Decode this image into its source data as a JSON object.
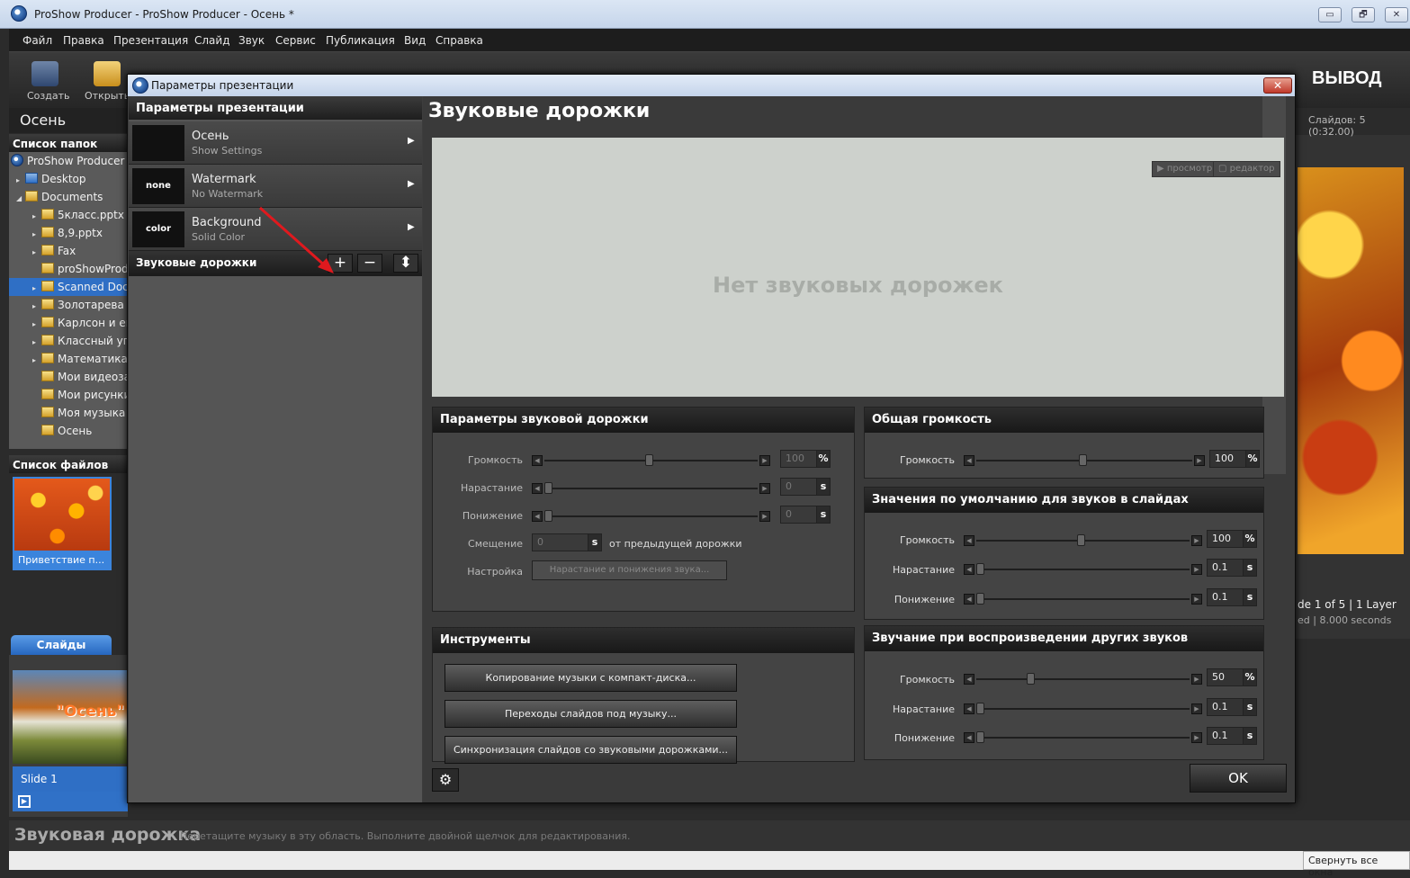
{
  "window": {
    "title": "ProShow Producer - ProShow Producer - Осень *",
    "min": "▭",
    "restore": "🗗",
    "close": "✕"
  },
  "menu": [
    "Файл",
    "Правка",
    "Презентация",
    "Слайд",
    "Звук",
    "Сервис",
    "Публикация",
    "Вид",
    "Справка"
  ],
  "toolbar": {
    "create": "Создать",
    "open": "Открыть",
    "output": "ВЫВОД"
  },
  "project_name": "Осень",
  "folder_list": {
    "title": "Список папок",
    "items": [
      "ProShow Producer",
      "Desktop",
      "Documents",
      "5класс.pptx",
      "8,9.pptx",
      "Fax",
      "proShowProd",
      "Scanned Doc",
      "Золотарева I",
      "Карлсон и ег",
      "Классный уг",
      "Математика",
      "Мои видеоза",
      "Мои рисунки",
      "Моя музыка",
      "Осень"
    ]
  },
  "file_list": {
    "title": "Список файлов",
    "thumb_label": "Приветствие п..."
  },
  "slides": {
    "tab": "Слайды",
    "slide_label": "Slide 1",
    "slide_title": "\"Осень\""
  },
  "right_panel": {
    "slides_count": "Слайдов: 5 (0:32.00)",
    "info1": "de 1 of 5  |  1 Layer",
    "info2": "ed  |  8.000 seconds"
  },
  "bottom": {
    "soundtrack": "Звуковая дорожка",
    "hint": "Перетащите музыку в эту область. Выполните двойной щелчок для редактирования.",
    "collapse": "Свернуть все окна"
  },
  "dialog": {
    "title": "Параметры презентации",
    "left_header": "Параметры презентации",
    "items": [
      {
        "thumb": "",
        "name": "Осень",
        "sub": "Show Settings"
      },
      {
        "thumb": "none",
        "name": "Watermark",
        "sub": "No Watermark"
      },
      {
        "thumb": "color",
        "name": "Background",
        "sub": "Solid Color"
      }
    ],
    "tracks_label": "Звуковые дорожки",
    "add": "+",
    "remove": "−",
    "move": "⬍",
    "main_header": "Звуковые дорожки",
    "no_tracks": "Нет звуковых дорожек",
    "preview_btn": "▶ просмотр",
    "editor_btn": "▢ редактор",
    "track_params": {
      "title": "Параметры звуковой дорожки",
      "volume_label": "Громкость",
      "volume": "100",
      "volume_unit": "%",
      "fade_in_label": "Нарастание",
      "fade_in": "0",
      "fade_in_unit": "s",
      "fade_out_label": "Понижение",
      "fade_out": "0",
      "fade_out_unit": "s",
      "offset_label": "Смещение",
      "offset": "0",
      "offset_unit": "s",
      "offset_text": "от предыдущей дорожки",
      "setting_label": "Настройка",
      "setting_btn": "Нарастание и понижения звука..."
    },
    "tools": {
      "title": "Инструменты",
      "btn1": "Копирование музыки с компакт-диска...",
      "btn2": "Переходы слайдов под музыку...",
      "btn3": "Синхронизация слайдов со звуковыми дорожками..."
    },
    "overall": {
      "title": "Общая громкость",
      "volume_label": "Громкость",
      "volume": "100",
      "unit": "%"
    },
    "defaults": {
      "title": "Значения по умолчанию для звуков в слайдах",
      "volume_label": "Громкость",
      "volume": "100",
      "volume_unit": "%",
      "fade_in_label": "Нарастание",
      "fade_in": "0.1",
      "fade_in_unit": "s",
      "fade_out_label": "Понижение",
      "fade_out": "0.1",
      "fade_out_unit": "s"
    },
    "other": {
      "title": "Звучание при воспроизведении других звуков",
      "volume_label": "Громкость",
      "volume": "50",
      "volume_unit": "%",
      "fade_in_label": "Нарастание",
      "fade_in": "0.1",
      "fade_in_unit": "s",
      "fade_out_label": "Понижение",
      "fade_out": "0.1",
      "fade_out_unit": "s"
    },
    "ok": "OK",
    "gear": "⚙"
  },
  "colors": {
    "selection": "#2f6fc5",
    "annotation_arrow": "#e0191e"
  }
}
